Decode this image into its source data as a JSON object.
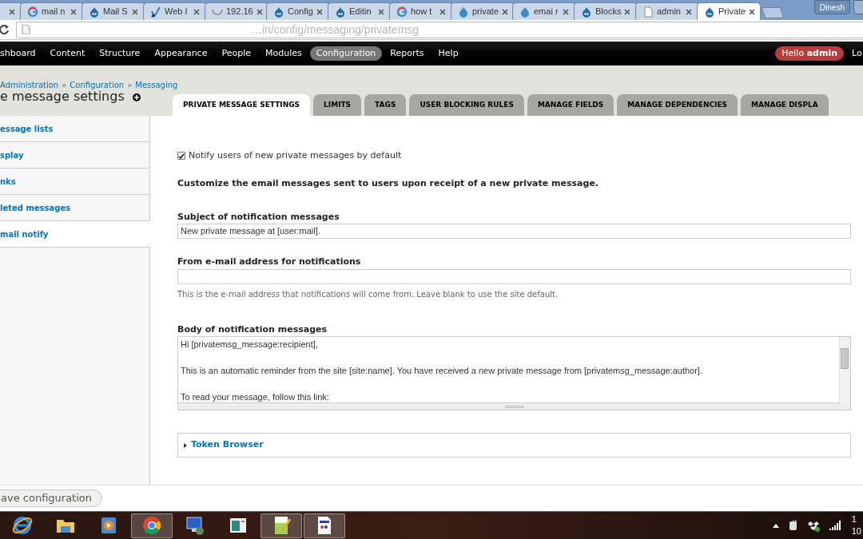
{
  "browser": {
    "tabs": [
      {
        "selected": false
      },
      {
        "title": "mail n",
        "selected": false
      },
      {
        "title": "Mail S",
        "selected": false
      },
      {
        "title": "Web I",
        "selected": false
      },
      {
        "title": "192.16",
        "selected": false
      },
      {
        "title": "Config",
        "selected": false
      },
      {
        "title": "Editin",
        "selected": false
      },
      {
        "title": "how t",
        "selected": false
      },
      {
        "title": "private",
        "selected": false
      },
      {
        "title": "emai r",
        "selected": false
      },
      {
        "title": "Blocks",
        "selected": false
      },
      {
        "title": "admin",
        "selected": false
      },
      {
        "title": "Private",
        "selected": true
      }
    ],
    "profile": "Dinesh",
    "address": "…in/config/messaging/privatemsg"
  },
  "toolbar": {
    "items": [
      {
        "label": "shboard",
        "selected": false
      },
      {
        "label": "Content",
        "selected": false
      },
      {
        "label": "Structure",
        "selected": false
      },
      {
        "label": "Appearance",
        "selected": false
      },
      {
        "label": "People",
        "selected": false
      },
      {
        "label": "Modules",
        "selected": false
      },
      {
        "label": "Configuration",
        "selected": true
      },
      {
        "label": "Reports",
        "selected": false
      },
      {
        "label": "Help",
        "selected": false
      }
    ],
    "greeting": "Hello **admin**",
    "logout": "Lo"
  },
  "breadcrumb": [
    "Administration",
    "»",
    "Configuration",
    "»",
    "Messaging"
  ],
  "title": "e message settings",
  "tabs": [
    {
      "label": "PRIVATE MESSAGE SETTINGS",
      "selected": true
    },
    {
      "label": "LIMITS",
      "selected": false
    },
    {
      "label": "TAGS",
      "selected": false
    },
    {
      "label": "USER BLOCKING RULES",
      "selected": false
    },
    {
      "label": "MANAGE FIELDS",
      "selected": false
    },
    {
      "label": "MANAGE DEPENDENCIES",
      "selected": false
    },
    {
      "label": "MANAGE DISPLA",
      "selected": false
    }
  ],
  "sidebar": {
    "items": [
      {
        "label": "essage lists",
        "selected": false
      },
      {
        "label": "splay",
        "selected": false
      },
      {
        "label": "nks",
        "selected": false
      },
      {
        "label": "leted messages",
        "selected": false
      },
      {
        "label": "mail notify",
        "selected": true
      }
    ]
  },
  "form": {
    "checkbox": {
      "label": "Notify users of new private messages by default",
      "checked": true
    },
    "intro": "Customize the email messages sent to users upon receipt of a new private message.",
    "subject": {
      "label": "Subject of notification messages",
      "value": "New private message at [user:mail]."
    },
    "from": {
      "label": "From e-mail address for notifications",
      "description": "This is the e-mail address that notifications will come from. Leave blank to use the site default."
    },
    "body": {
      "label": "Body of notification messages",
      "paragraphs": [
        "Hi [privatemsg_message:recipient],",
        "This is an automatic reminder from the site [site:name]. You have received a new private message from [privatemsg_message:author].",
        "To read your message, follow this link:"
      ]
    },
    "token_browser": {
      "label": "Token Browser",
      "expanded": false
    },
    "save": "ave configuration"
  },
  "taskbar": {
    "apps": [
      {
        "selected": false
      },
      {
        "selected": false
      },
      {
        "selected": false
      },
      {
        "selected": true
      },
      {
        "selected": false
      },
      {
        "selected": false
      },
      {
        "selected": true
      },
      {
        "selected": true
      }
    ],
    "clock": [
      "1",
      "10"
    ]
  }
}
